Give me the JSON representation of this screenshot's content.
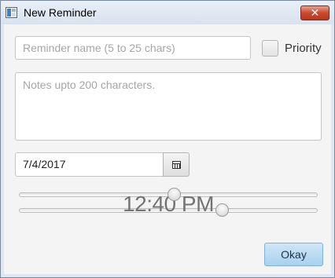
{
  "window": {
    "title": "New Reminder",
    "close_symbol": "✕"
  },
  "form": {
    "name_placeholder": "Reminder name (5  to 25 chars)",
    "notes_placeholder": "Notes upto 200 characters.",
    "priority_label": "Priority",
    "priority_checked": false,
    "date_value": "7/4/2017",
    "time_display": "12:40 PM",
    "hour_slider_fraction": 0.52,
    "minute_slider_fraction": 0.68,
    "submit_label": "Okay"
  },
  "icons": {
    "app": "window-app-icon",
    "close": "close-icon",
    "calendar": "calendar-icon"
  }
}
